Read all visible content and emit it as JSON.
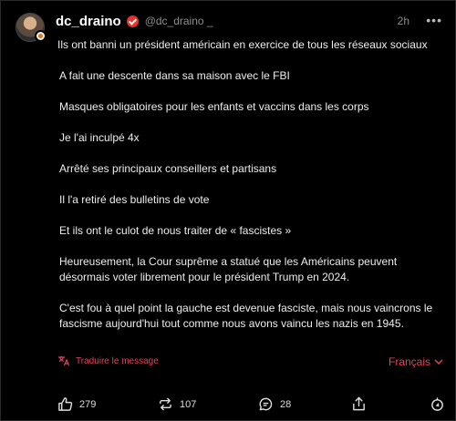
{
  "post": {
    "username": "dc_draino",
    "handle": "@dc_draino _",
    "time": "2h",
    "more_label": "•••",
    "paragraphs": [
      "Ils ont banni un président américain en exercice de tous les réseaux sociaux",
      "A fait une descente dans sa maison avec le FBI",
      "Masques obligatoires pour les enfants et vaccins dans les corps",
      "Je l'ai inculpé 4x",
      "Arrêté ses principaux conseillers et partisans",
      "Il l'a retiré des bulletins de vote",
      "Et ils ont le culot de nous traiter de « fascistes »",
      "Heureusement, la Cour suprême a statué que les Américains peuvent désormais voter librement pour le président Trump en 2024.",
      "C'est fou à quel point la gauche est devenue fasciste, mais nous vaincrons le fascisme aujourd'hui tout comme nous avons vaincu les nazis en 1945."
    ],
    "translate_label": "Traduire le message",
    "language_label": "Français"
  },
  "actions": {
    "likes": "279",
    "reposts": "107",
    "comments": "28"
  },
  "colors": {
    "accent": "#e0445a",
    "background": "#000000",
    "text": "#ededed",
    "muted": "#8d8d8d"
  }
}
